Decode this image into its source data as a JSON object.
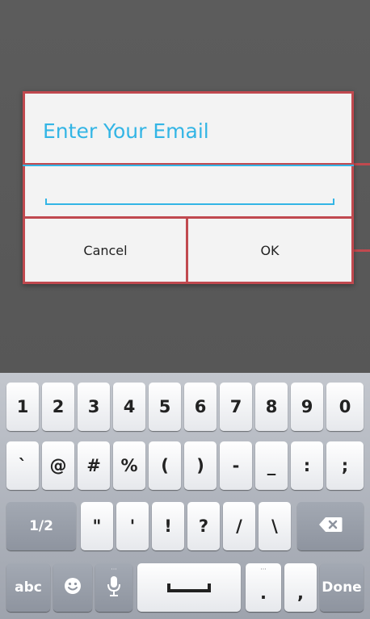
{
  "dialog": {
    "title": "Enter Your Email",
    "input_value": "",
    "cancel_label": "Cancel",
    "ok_label": "OK"
  },
  "keyboard": {
    "row1": [
      "1",
      "2",
      "3",
      "4",
      "5",
      "6",
      "7",
      "8",
      "9",
      "0"
    ],
    "row2": [
      "`",
      "@",
      "#",
      "%",
      "(",
      ")",
      "-",
      "_",
      ":",
      ";"
    ],
    "row3": {
      "toggle": "1/2",
      "keys": [
        "\"",
        "'",
        "!",
        "?",
        "/",
        "\\"
      ],
      "backspace_icon": "backspace-icon"
    },
    "row4": {
      "abc": "abc",
      "emoji_icon": "smiley-icon",
      "mic_icon": "microphone-icon",
      "space_icon": "space-bar-icon",
      "period": ".",
      "comma": ",",
      "done": "Done"
    }
  },
  "colors": {
    "accent": "#33b5e5",
    "annotation": "#c0494f"
  }
}
